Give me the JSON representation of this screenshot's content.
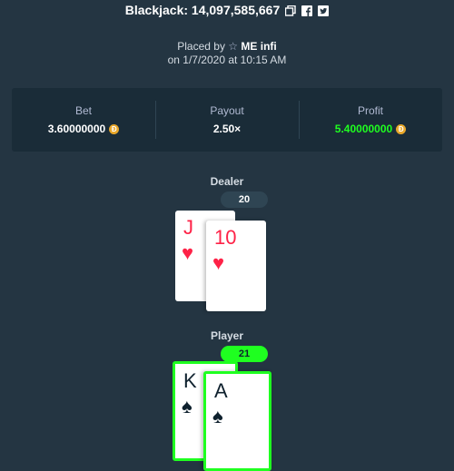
{
  "header": {
    "title": "Blackjack: 14,097,585,667",
    "icons": [
      "copy-icon",
      "facebook-icon",
      "twitter-icon"
    ]
  },
  "placed": {
    "prefix": "Placed by",
    "user": "ME infi",
    "date_line": "on 1/7/2020 at 10:15 AM"
  },
  "stats": {
    "bet_label": "Bet",
    "bet_value": "3.60000000",
    "payout_label": "Payout",
    "payout_value": "2.50×",
    "profit_label": "Profit",
    "profit_value": "5.40000000",
    "currency_symbol": "Đ"
  },
  "dealer": {
    "label": "Dealer",
    "score": "20",
    "cards": [
      {
        "rank": "J",
        "suit": "♥"
      },
      {
        "rank": "10",
        "suit": "♥"
      }
    ]
  },
  "player": {
    "label": "Player",
    "score": "21",
    "cards": [
      {
        "rank": "K",
        "suit": "♠"
      },
      {
        "rank": "A",
        "suit": "♠"
      }
    ]
  },
  "colors": {
    "background": "#243542",
    "panel": "#1a2c38",
    "win_green": "#1fff20",
    "heart_red": "#fe2247",
    "coin": "#e8a72a"
  }
}
